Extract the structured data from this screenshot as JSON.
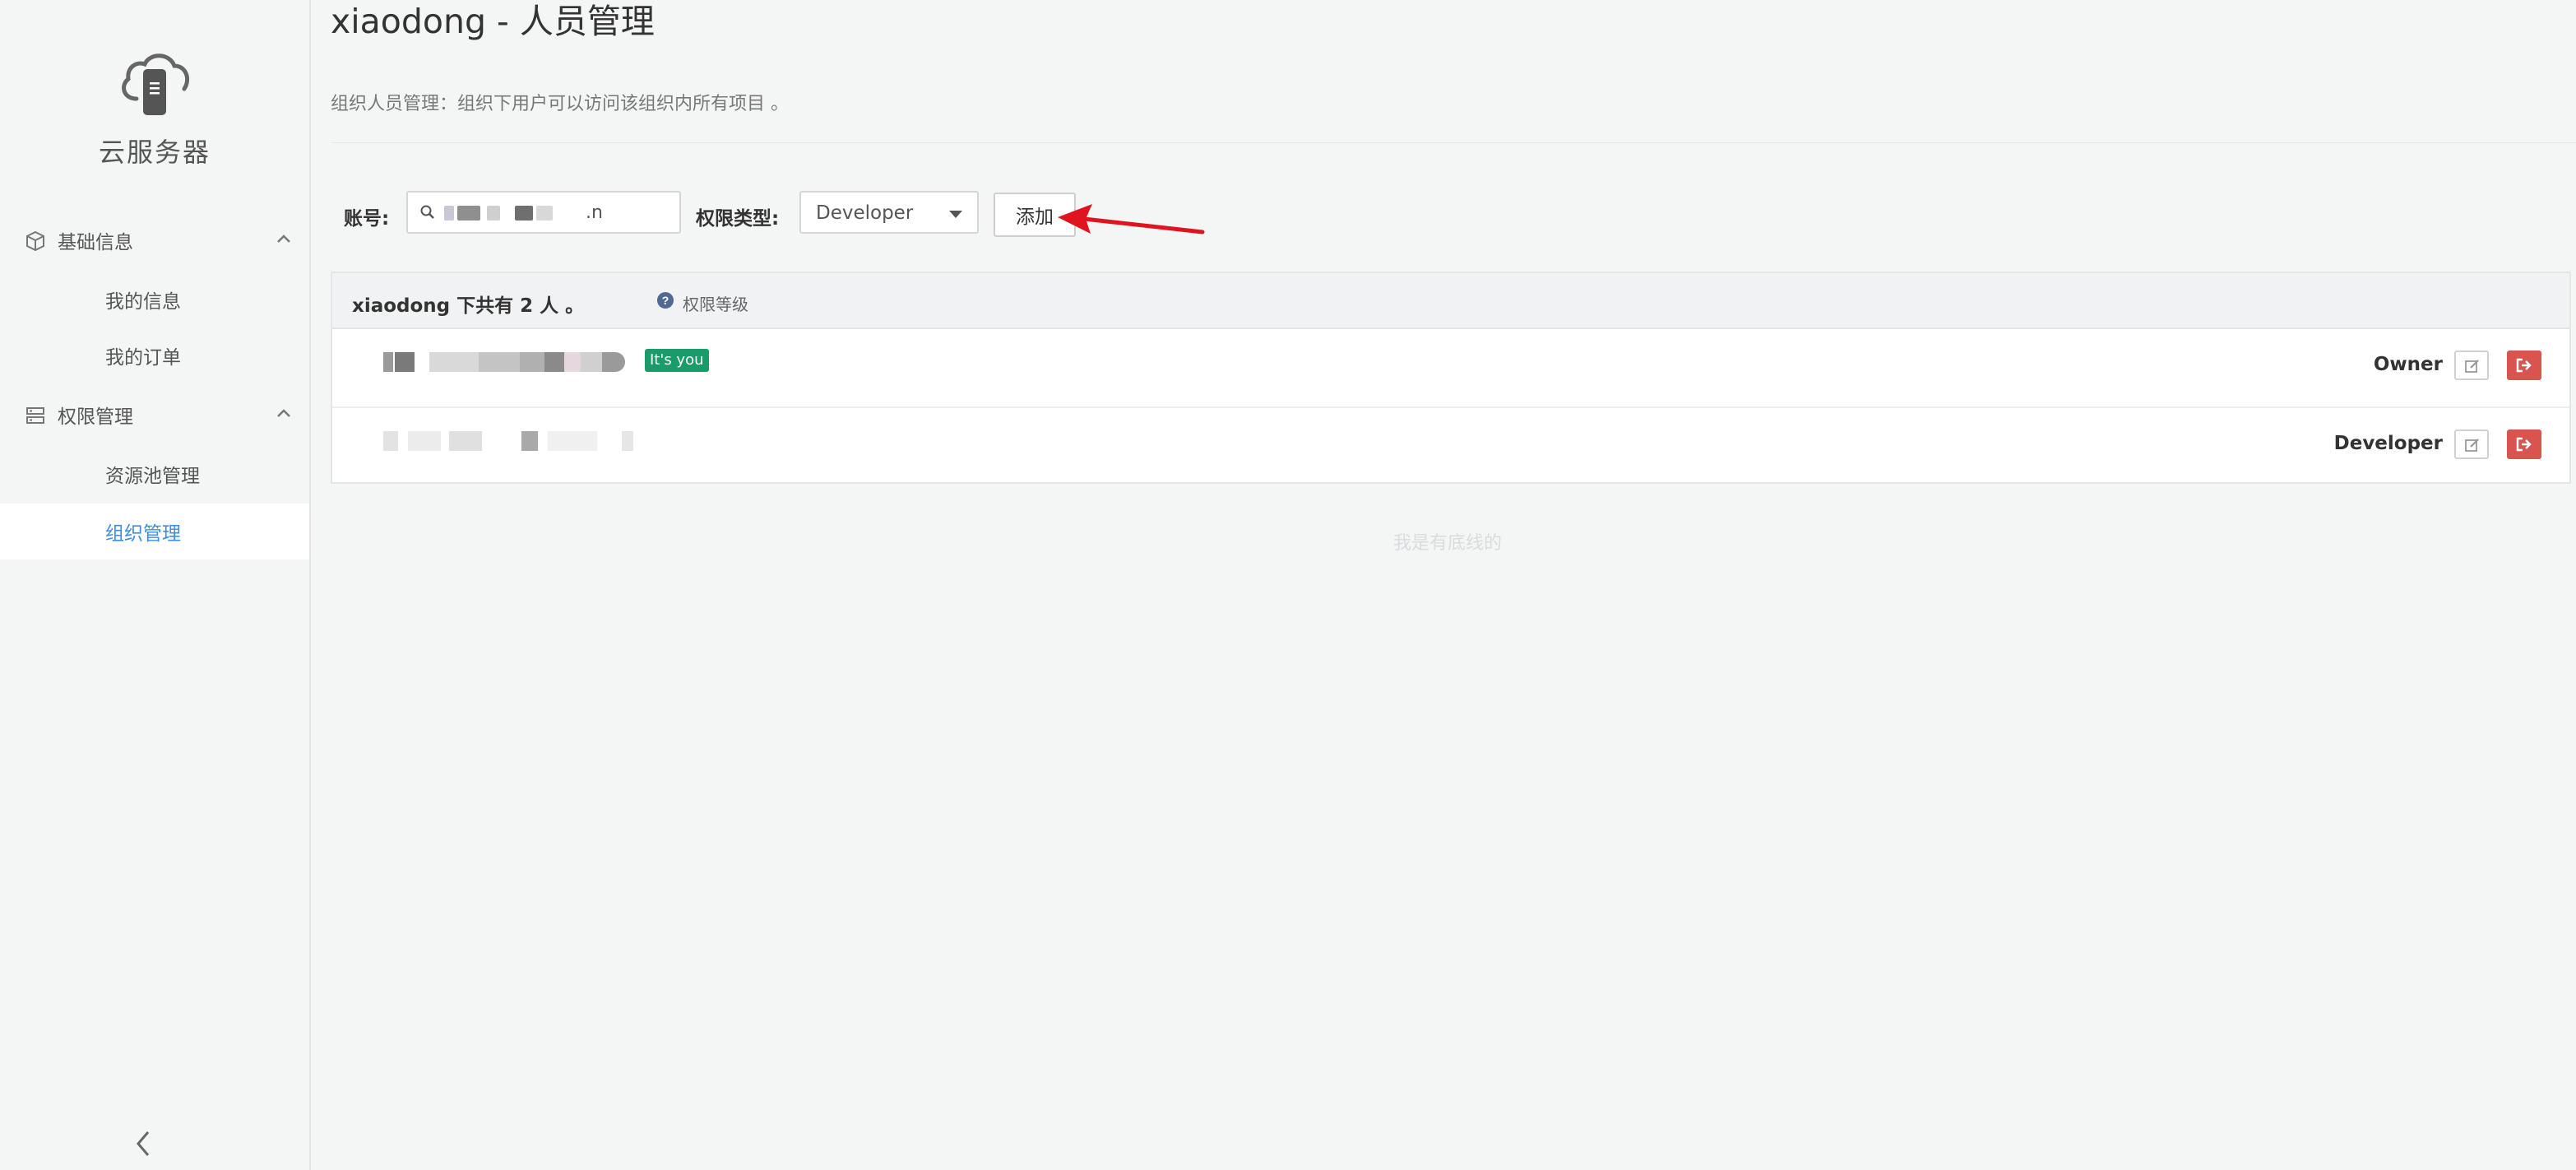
{
  "sidebar": {
    "logo_text": "云服务器",
    "groups": [
      {
        "label": "基础信息",
        "icon": "cube-icon",
        "items": [
          {
            "label": "我的信息"
          },
          {
            "label": "我的订单"
          }
        ]
      },
      {
        "label": "权限管理",
        "icon": "server-icon",
        "items": [
          {
            "label": "资源池管理"
          },
          {
            "label": "组织管理",
            "active": true
          }
        ]
      }
    ]
  },
  "page": {
    "title": "xiaodong - 人员管理",
    "description": "组织人员管理：组织下用户可以访问该组织内所有项目 。"
  },
  "form": {
    "account_label": "账号:",
    "account_value_suffix": ".n",
    "permission_label": "权限类型:",
    "permission_value": "Developer",
    "add_label": "添加"
  },
  "members": {
    "summary": "xiaodong 下共有 2 人 。",
    "permission_levels_link": "权限等级",
    "rows": [
      {
        "self_badge": "It's you",
        "role": "Owner"
      },
      {
        "role": "Developer"
      }
    ]
  },
  "footer_note": "我是有底线的",
  "colors": {
    "accent": "#3a8ee6",
    "badge": "#1a9c6a",
    "danger": "#d9534f",
    "arrow": "#e0141e"
  }
}
